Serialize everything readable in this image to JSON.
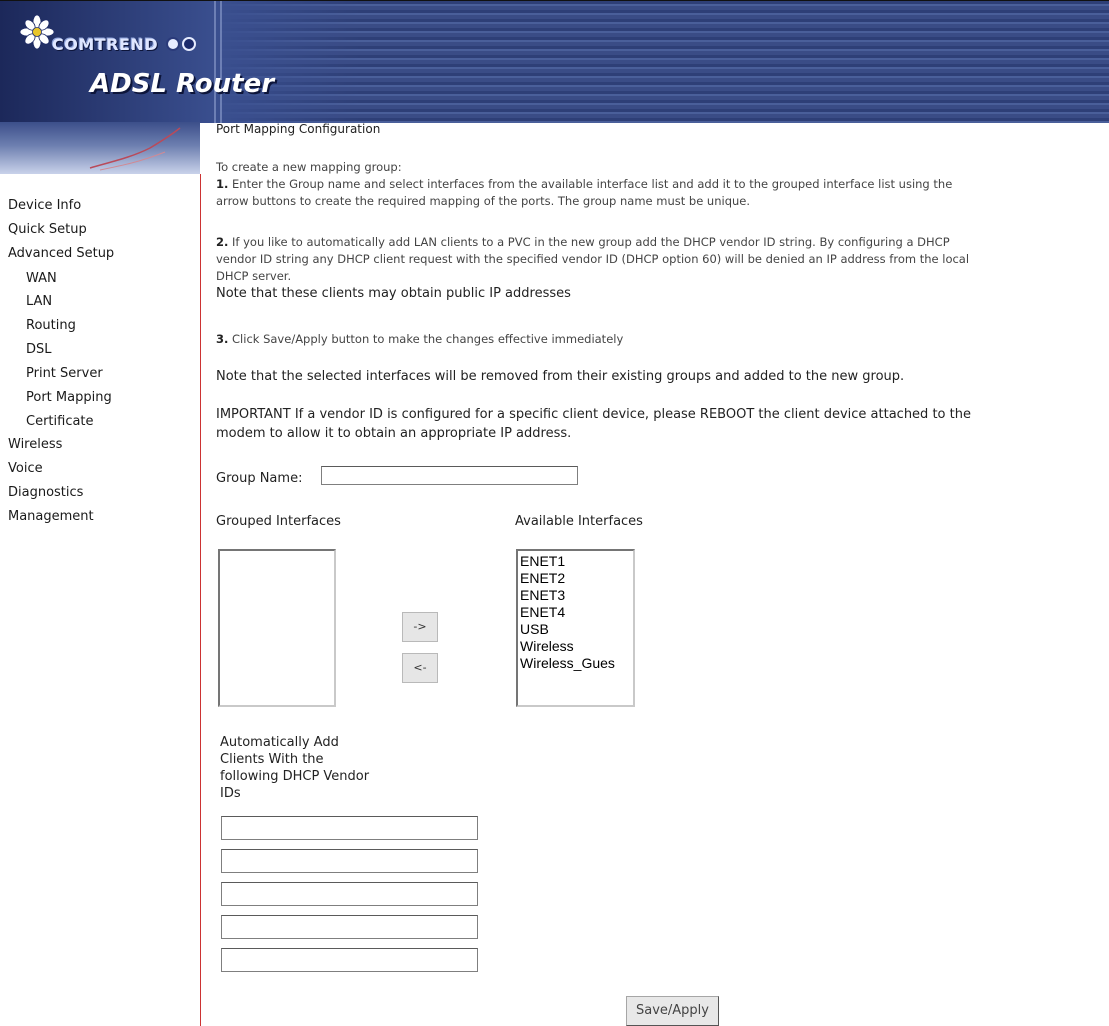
{
  "header": {
    "brand": "COMTREND",
    "product": "ADSL Router"
  },
  "sidebar": {
    "items": [
      {
        "label": "Device Info"
      },
      {
        "label": "Quick Setup"
      },
      {
        "label": "Advanced Setup"
      },
      {
        "label": "WAN"
      },
      {
        "label": "LAN"
      },
      {
        "label": "Routing"
      },
      {
        "label": "DSL"
      },
      {
        "label": "Print Server"
      },
      {
        "label": "Port Mapping"
      },
      {
        "label": "Certificate"
      },
      {
        "label": "Wireless"
      },
      {
        "label": "Voice"
      },
      {
        "label": "Diagnostics"
      },
      {
        "label": "Management"
      }
    ]
  },
  "page": {
    "title": "Port Mapping Configuration",
    "intro": "To create a new mapping group:",
    "step1_num": "1.",
    "step1_line1": "Enter the Group name and select interfaces from the available interface list and add it to the grouped interface list using the",
    "step1_line2": "arrow buttons to create the required mapping of the ports. The group name must be unique.",
    "step2_num": "2.",
    "step2_line1": "If you like to automatically add LAN clients to a PVC in the new group add the DHCP vendor ID string. By configuring a DHCP",
    "step2_line2": "vendor ID string any DHCP client request with the specified vendor ID (DHCP option 60) will be denied an IP address from the local",
    "step2_line3": "DHCP server.",
    "step2_note": "Note that these clients may obtain public IP addresses",
    "step3_num": "3.",
    "step3_text": "Click Save/Apply button to make the changes effective immediately",
    "note_removed": "Note that the selected interfaces will be removed from their existing groups and added to the new group.",
    "important_line1": "IMPORTANT If a vendor ID is configured for a specific client device, please REBOOT the client device attached to the",
    "important_line2": "modem to allow it to obtain an appropriate IP address."
  },
  "form": {
    "group_name_label": "Group Name:",
    "group_name_value": "",
    "grouped_label": "Grouped Interfaces",
    "available_label": "Available Interfaces",
    "grouped_items": [],
    "available_items": [
      "ENET1",
      "ENET2",
      "ENET3",
      "ENET4",
      "USB",
      "Wireless",
      "Wireless_Gues"
    ],
    "add_button": "->",
    "remove_button": "<-",
    "vendor_label_1": "Automatically Add",
    "vendor_label_2": "Clients With the",
    "vendor_label_3": "following DHCP Vendor",
    "vendor_label_4": "IDs",
    "vendor_ids": [
      "",
      "",
      "",
      "",
      ""
    ],
    "save_button": "Save/Apply"
  }
}
